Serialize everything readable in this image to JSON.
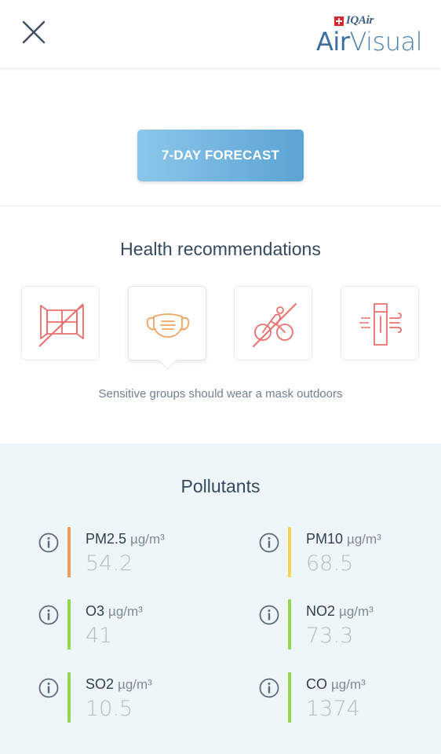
{
  "header": {
    "brand_badge": "IQAir",
    "brand_name_strong": "Air",
    "brand_name_light": "Visual"
  },
  "forecast": {
    "button_label": "7-DAY FORECAST"
  },
  "health": {
    "title": "Health recommendations",
    "cards": [
      {
        "icon": "close-windows-icon",
        "active": false
      },
      {
        "icon": "face-mask-icon",
        "active": true
      },
      {
        "icon": "no-cycling-icon",
        "active": false
      },
      {
        "icon": "air-purifier-icon",
        "active": false
      }
    ],
    "recommendation": "Sensitive groups should wear a mask outdoors",
    "colors": {
      "icon_red": "#e8716d",
      "icon_orange": "#f0a55f"
    }
  },
  "pollutants": {
    "title": "Pollutants",
    "items": [
      {
        "name": "PM2.5",
        "unit": "µg/m³",
        "value": "54.2",
        "color": "#f39a5b"
      },
      {
        "name": "PM10",
        "unit": "µg/m³",
        "value": "68.5",
        "color": "#f4d64e"
      },
      {
        "name": "O3",
        "unit": "µg/m³",
        "value": "41",
        "color": "#8fd84f"
      },
      {
        "name": "NO2",
        "unit": "µg/m³",
        "value": "73.3",
        "color": "#8fd84f"
      },
      {
        "name": "SO2",
        "unit": "µg/m³",
        "value": "10.5",
        "color": "#8fd84f"
      },
      {
        "name": "CO",
        "unit": "µg/m³",
        "value": "1374",
        "color": "#8fd84f"
      }
    ]
  }
}
